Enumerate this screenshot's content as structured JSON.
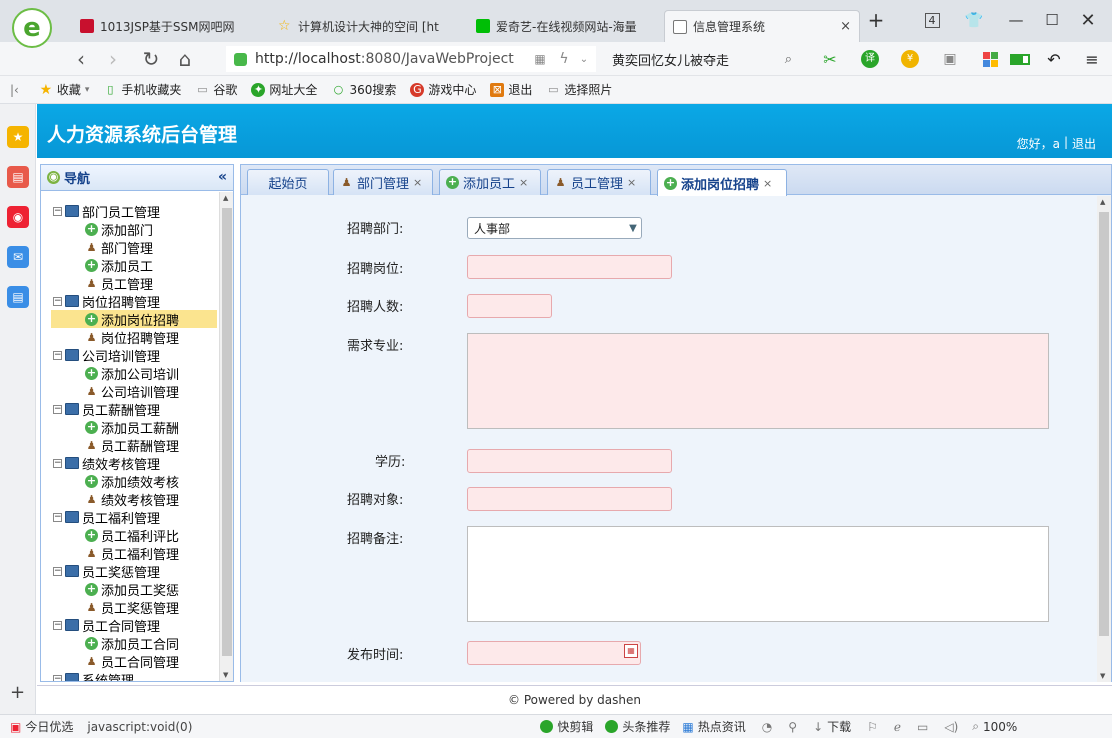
{
  "browser": {
    "logo_letter": "e",
    "tabs": [
      {
        "title": "1013JSP基于SSM网吧网",
        "color": "#c8102e"
      },
      {
        "title": "计算机设计大神的空间 [ht",
        "color": "#f5b400"
      },
      {
        "title": "爱奇艺-在线视频网站-海量",
        "color": "#00be06"
      },
      {
        "title": "信息管理系统",
        "color": "#777777",
        "close": "×"
      }
    ],
    "new_tab": "+",
    "tab_count": "4",
    "url_host": "http://localhost",
    "url_rest": ":8080/JavaWebProject",
    "search_text": "黄奕回忆女儿被夺走"
  },
  "bookmarks": [
    {
      "label": "收藏",
      "icon": "★",
      "color": "#f5b400"
    },
    {
      "label": "手机收藏夹",
      "icon": "▯",
      "color": "#2aa52a"
    },
    {
      "label": "谷歌",
      "icon": "▭",
      "color": "#888888"
    },
    {
      "label": "网址大全",
      "icon": "✦",
      "color": "#2aa52a"
    },
    {
      "label": "360搜索",
      "icon": "○",
      "color": "#2aa52a"
    },
    {
      "label": "游戏中心",
      "icon": "G",
      "color": "#d63a2a"
    },
    {
      "label": "退出",
      "icon": "⊠",
      "color": "#e07a10"
    },
    {
      "label": "选择照片",
      "icon": "▭",
      "color": "#888888"
    }
  ],
  "app": {
    "title": "人力资源系统后台管理",
    "greeting": "您好，a",
    "separator": "|",
    "logout": "退出"
  },
  "nav": {
    "title": "导航",
    "groups": [
      {
        "label": "部门员工管理",
        "items": [
          {
            "label": "添加部门",
            "type": "add"
          },
          {
            "label": "部门管理",
            "type": "user"
          },
          {
            "label": "添加员工",
            "type": "add"
          },
          {
            "label": "员工管理",
            "type": "user"
          }
        ]
      },
      {
        "label": "岗位招聘管理",
        "items": [
          {
            "label": "添加岗位招聘",
            "type": "add",
            "selected": true
          },
          {
            "label": "岗位招聘管理",
            "type": "user"
          }
        ]
      },
      {
        "label": "公司培训管理",
        "items": [
          {
            "label": "添加公司培训",
            "type": "add"
          },
          {
            "label": "公司培训管理",
            "type": "user"
          }
        ]
      },
      {
        "label": "员工薪酬管理",
        "items": [
          {
            "label": "添加员工薪酬",
            "type": "add"
          },
          {
            "label": "员工薪酬管理",
            "type": "user"
          }
        ]
      },
      {
        "label": "绩效考核管理",
        "items": [
          {
            "label": "添加绩效考核",
            "type": "add"
          },
          {
            "label": "绩效考核管理",
            "type": "user"
          }
        ]
      },
      {
        "label": "员工福利管理",
        "items": [
          {
            "label": "员工福利评比",
            "type": "add"
          },
          {
            "label": "员工福利管理",
            "type": "user"
          }
        ]
      },
      {
        "label": "员工奖惩管理",
        "items": [
          {
            "label": "添加员工奖惩",
            "type": "add"
          },
          {
            "label": "员工奖惩管理",
            "type": "user"
          }
        ]
      },
      {
        "label": "员工合同管理",
        "items": [
          {
            "label": "添加员工合同",
            "type": "add"
          },
          {
            "label": "员工合同管理",
            "type": "user"
          }
        ]
      },
      {
        "label": "系统管理",
        "items": []
      }
    ]
  },
  "tabs": [
    {
      "label": "起始页",
      "icon": "",
      "close": ""
    },
    {
      "label": "部门管理",
      "icon": "user",
      "close": "×"
    },
    {
      "label": "添加员工",
      "icon": "add",
      "close": "×"
    },
    {
      "label": "员工管理",
      "icon": "user",
      "close": "×"
    },
    {
      "label": "添加岗位招聘",
      "icon": "add",
      "close": "×",
      "active": true
    }
  ],
  "form": {
    "department_label": "招聘部门:",
    "department_value": "人事部",
    "position_label": "招聘岗位:",
    "count_label": "招聘人数:",
    "major_label": "需求专业:",
    "education_label": "学历:",
    "target_label": "招聘对象:",
    "remark_label": "招聘备注:",
    "publish_time_label": "发布时间:"
  },
  "footer": {
    "text": "© Powered by dashen"
  },
  "status": {
    "today": "今日优选",
    "link": "javascript:void(0)",
    "quick_cut": "快剪辑",
    "headline": "头条推荐",
    "hot": "热点资讯",
    "download": "下载",
    "zoom": "100%"
  }
}
